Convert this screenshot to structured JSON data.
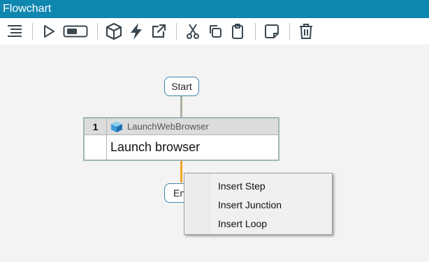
{
  "window": {
    "title": "Flowchart"
  },
  "toolbar": {
    "items": [
      {
        "name": "list-icon"
      },
      {
        "name": "play-icon"
      },
      {
        "name": "toggle-icon"
      },
      {
        "name": "package-icon"
      },
      {
        "name": "lightning-icon"
      },
      {
        "name": "external-link-icon"
      },
      {
        "name": "cut-icon"
      },
      {
        "name": "copy-icon"
      },
      {
        "name": "paste-icon"
      },
      {
        "name": "note-icon"
      },
      {
        "name": "trash-icon"
      }
    ]
  },
  "flow": {
    "start_label": "Start",
    "end_label": "En",
    "step": {
      "number": "1",
      "type": "LaunchWebBrowser",
      "label": "Launch browser"
    }
  },
  "context_menu": {
    "items": [
      "Insert Step",
      "Insert Junction",
      "Insert Loop"
    ]
  },
  "colors": {
    "titlebar": "#0f87b0",
    "icon": "#3a4750",
    "connector_active": "#f5a623",
    "node_border": "#3d86a8"
  }
}
